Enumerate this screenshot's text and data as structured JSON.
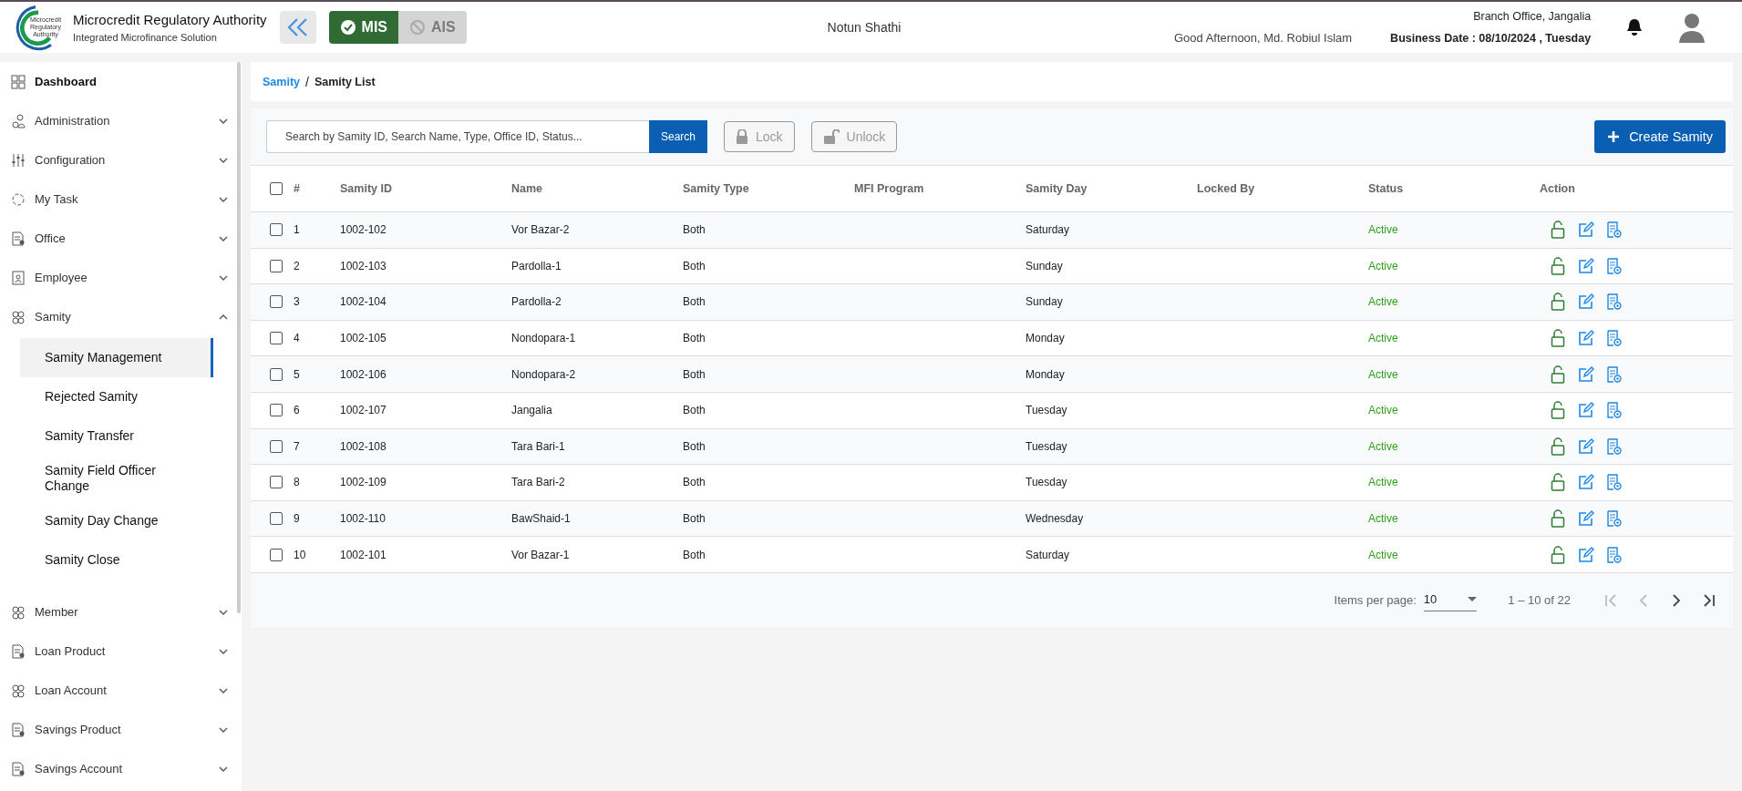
{
  "header": {
    "org_name": "Microcredit Regulatory Authority",
    "org_subtitle": "Integrated Microfinance Solution",
    "logo_text": [
      "Microcredit",
      "Regulatory",
      "Authority"
    ],
    "modes": [
      {
        "label": "MIS",
        "selected": true
      },
      {
        "label": "AIS",
        "selected": false
      }
    ],
    "center_title": "Notun Shathi",
    "greeting": "Good Afternoon, Md. Robiul Islam",
    "branch": "Branch Office, Jangalia",
    "business_date": "Business Date : 08/10/2024 , Tuesday"
  },
  "sidebar": {
    "items": [
      {
        "label": "Dashboard",
        "kind": "link"
      },
      {
        "label": "Administration",
        "kind": "group",
        "expanded": false
      },
      {
        "label": "Configuration",
        "kind": "group",
        "expanded": false
      },
      {
        "label": "My Task",
        "kind": "group",
        "expanded": false
      },
      {
        "label": "Office",
        "kind": "group",
        "expanded": false
      },
      {
        "label": "Employee",
        "kind": "group",
        "expanded": false
      },
      {
        "label": "Samity",
        "kind": "group",
        "expanded": true,
        "children": [
          {
            "label": "Samity Management",
            "selected": true
          },
          {
            "label": "Rejected Samity",
            "selected": false
          },
          {
            "label": "Samity Transfer",
            "selected": false
          },
          {
            "label": "Samity Field Officer Change",
            "selected": false
          },
          {
            "label": "Samity Day Change",
            "selected": false
          },
          {
            "label": "Samity Close",
            "selected": false
          }
        ]
      },
      {
        "label": "Member",
        "kind": "group",
        "expanded": false
      },
      {
        "label": "Loan Product",
        "kind": "group",
        "expanded": false
      },
      {
        "label": "Loan Account",
        "kind": "group",
        "expanded": false
      },
      {
        "label": "Savings Product",
        "kind": "group",
        "expanded": false
      },
      {
        "label": "Savings Account",
        "kind": "group",
        "expanded": false
      }
    ]
  },
  "breadcrumb": [
    {
      "label": "Samity",
      "link": true
    },
    {
      "label": "Samity List",
      "link": false
    }
  ],
  "breadcrumb_separator": "/",
  "toolbar": {
    "search": {
      "placeholder": "Search by Samity ID, Search Name, Type, Office ID, Status..."
    },
    "search_button": "Search",
    "lock_button": {
      "label": "Lock",
      "disabled": true
    },
    "unlock_button": {
      "label": "Unlock",
      "disabled": true
    },
    "create_button": "Create Samity"
  },
  "table": {
    "columns": [
      "#",
      "Samity ID",
      "Name",
      "Samity Type",
      "MFI Program",
      "Samity Day",
      "Locked By",
      "Status",
      "Action"
    ],
    "all_checked": false,
    "rows": [
      {
        "checked": false,
        "no": "1",
        "id": "1002-102",
        "name": "Vor Bazar-2",
        "type": "Both",
        "day": "Saturday",
        "status": "Active"
      },
      {
        "checked": false,
        "no": "2",
        "id": "1002-103",
        "name": "Pardolla-1",
        "type": "Both",
        "day": "Sunday",
        "status": "Active"
      },
      {
        "checked": false,
        "no": "3",
        "id": "1002-104",
        "name": "Pardolla-2",
        "type": "Both",
        "day": "Sunday",
        "status": "Active"
      },
      {
        "checked": false,
        "no": "4",
        "id": "1002-105",
        "name": "Nondopara-1",
        "type": "Both",
        "day": "Monday",
        "status": "Active"
      },
      {
        "checked": false,
        "no": "5",
        "id": "1002-106",
        "name": "Nondopara-2",
        "type": "Both",
        "day": "Monday",
        "status": "Active"
      },
      {
        "checked": false,
        "no": "6",
        "id": "1002-107",
        "name": "Jangalia",
        "type": "Both",
        "day": "Tuesday",
        "status": "Active"
      },
      {
        "checked": false,
        "no": "7",
        "id": "1002-108",
        "name": "Tara Bari-1",
        "type": "Both",
        "day": "Tuesday",
        "status": "Active"
      },
      {
        "checked": false,
        "no": "8",
        "id": "1002-109",
        "name": "Tara Bari-2",
        "type": "Both",
        "day": "Tuesday",
        "status": "Active"
      },
      {
        "checked": false,
        "no": "9",
        "id": "1002-110",
        "name": "BawShaid-1",
        "type": "Both",
        "day": "Wednesday",
        "status": "Active"
      },
      {
        "checked": false,
        "no": "10",
        "id": "1002-101",
        "name": "Vor Bazar-1",
        "type": "Both",
        "day": "Saturday",
        "status": "Active"
      }
    ]
  },
  "paginator": {
    "label": "Items per page:",
    "page_size": "10",
    "range": "1 – 10 of 22",
    "first_disabled": true,
    "prev_disabled": true,
    "next_disabled": false,
    "last_disabled": false
  }
}
